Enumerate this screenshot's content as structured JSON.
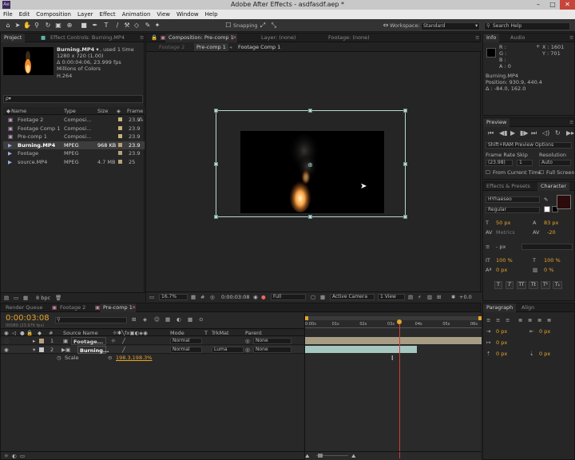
{
  "app": {
    "title": "Adobe After Effects - asdfasdf.aep *",
    "logo": "Ae"
  },
  "menu": [
    "File",
    "Edit",
    "Composition",
    "Layer",
    "Effect",
    "Animation",
    "View",
    "Window",
    "Help"
  ],
  "toolbar": {
    "snapping_label": "Snapping",
    "workspace_label": "Workspace:",
    "workspace_value": "Standard",
    "search_placeholder": "Search Help"
  },
  "project": {
    "tab_project": "Project",
    "tab_effect_controls": "Effect Controls: Burning.MP4",
    "item_name": "Burning.MP4 ▾",
    "item_used": ", used 1 time",
    "info_lines": [
      "1280 x 720 (1.00)",
      "Δ 0:00:04:06, 23.999 fps",
      "Millions of Colors",
      "H.264"
    ],
    "search_placeholder": "ρ▾",
    "columns": [
      "Name",
      "Type",
      "Size",
      "Frame ..."
    ],
    "rows": [
      {
        "name": "Footage 2",
        "type": "Composi...",
        "size": "",
        "fps": "23.9"
      },
      {
        "name": "Footage Comp 1",
        "type": "Composi...",
        "size": "",
        "fps": "23.9"
      },
      {
        "name": "Pre-comp 1",
        "type": "Composi...",
        "size": "",
        "fps": "23.9"
      },
      {
        "name": "Burning.MP4",
        "type": "MPEG",
        "size": "968 KB",
        "fps": "23.9"
      },
      {
        "name": "Footage",
        "type": "MPEG",
        "size": "",
        "fps": "23.9"
      },
      {
        "name": "source.MP4",
        "type": "MPEG",
        "size": "4.7 MB",
        "fps": "25"
      }
    ],
    "bpc": "8 bpc"
  },
  "composition": {
    "tab_comp": "Composition: Pre-comp 1",
    "tab_layer": "Layer: (none)",
    "tab_footage": "Footage: (none)",
    "crumbs": [
      "Footage 2",
      "Pre-comp 1",
      "Footage Comp 1"
    ],
    "zoom": "16.7%",
    "timecode": "0:00:03:08",
    "resolution": "Full",
    "camera": "Active Camera",
    "view": "1 View",
    "exposure": "+0.0"
  },
  "info": {
    "tab_info": "Info",
    "tab_audio": "Audio",
    "rgba_labels": [
      "R :",
      "G :",
      "B :",
      "A : 0"
    ],
    "x": "X : 1601",
    "y": "Y : 701",
    "lines": [
      "Burning.MP4",
      "Position: 930.9, 440.4",
      "Δ : -84.0, 162.0"
    ]
  },
  "preview": {
    "tab": "Preview",
    "mode": "Shift+RAM Preview Options",
    "frame_rate_label": "Frame Rate",
    "skip_label": "Skip",
    "resolution_label": "Resolution",
    "frame_rate": "(23.98)",
    "skip": "1",
    "resolution": "Auto",
    "from_current": "From Current Time",
    "full_screen": "Full Screen"
  },
  "character": {
    "tab_effects": "Effects & Presets",
    "tab_character": "Character",
    "font": "HYhaeseo",
    "style": "Regular",
    "size": "50 px",
    "leading": "83 px",
    "metrics": "Metrics",
    "tracking": "-20",
    "stroke": "- px",
    "vscale": "100 %",
    "hscale": "100 %",
    "baseline": "0 px",
    "tsume": "0 %",
    "faux_buttons": [
      "T",
      "T",
      "TT",
      "Tt",
      "T¹",
      "T₁"
    ]
  },
  "paragraph": {
    "tab_paragraph": "Paragraph",
    "tab_align": "Align",
    "values": [
      "0 px",
      "0 px",
      "0 px",
      "0 px",
      "0 px"
    ]
  },
  "timeline": {
    "tabs": [
      "Render Queue",
      "Footage 2",
      "Pre-comp 1"
    ],
    "timecode": "0:00:03:08",
    "frames": "00080 (23.976 fps)",
    "columns": [
      "#",
      "Source Name",
      "Mode",
      "T",
      "TrkMat",
      "Parent"
    ],
    "layers": [
      {
        "num": "1",
        "name": "Footage...",
        "mode": "Normal",
        "trkmat": "",
        "parent": "None"
      },
      {
        "num": "2",
        "name": "Burning...",
        "mode": "Normal",
        "trkmat": "Luma",
        "parent": "None"
      }
    ],
    "property_name": "Scale",
    "property_value": "198.3,198.3%",
    "ruler": [
      "0:00s",
      "01s",
      "02s",
      "03s",
      "04s",
      "05s",
      "06s"
    ],
    "playhead_seconds": 3.33,
    "duration_seconds": 6.5
  },
  "colors": {
    "accent": "#e7a52b",
    "playhead": "#d23b3b",
    "selection": "#b9d8d2"
  }
}
